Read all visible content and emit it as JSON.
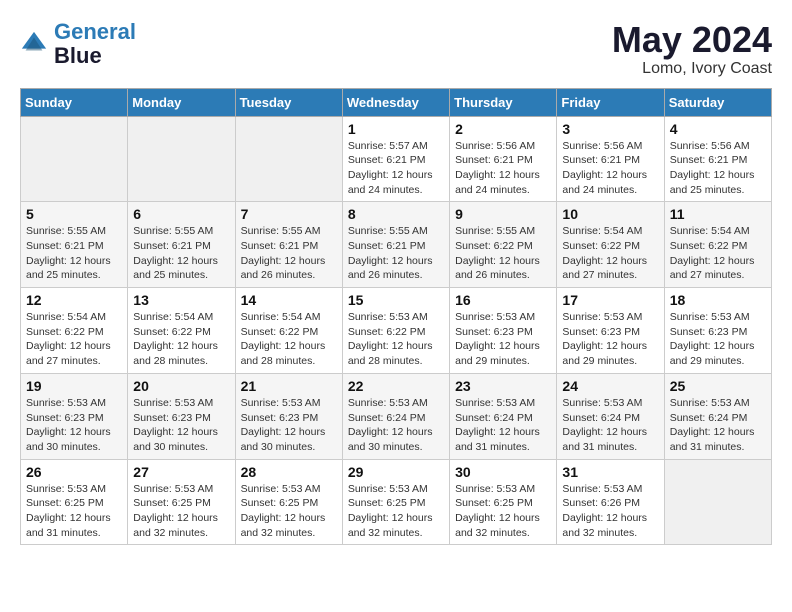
{
  "header": {
    "logo_line1": "General",
    "logo_line2": "Blue",
    "month_year": "May 2024",
    "location": "Lomo, Ivory Coast"
  },
  "days_of_week": [
    "Sunday",
    "Monday",
    "Tuesday",
    "Wednesday",
    "Thursday",
    "Friday",
    "Saturday"
  ],
  "weeks": [
    [
      {
        "day": "",
        "info": ""
      },
      {
        "day": "",
        "info": ""
      },
      {
        "day": "",
        "info": ""
      },
      {
        "day": "1",
        "info": "Sunrise: 5:57 AM\nSunset: 6:21 PM\nDaylight: 12 hours\nand 24 minutes."
      },
      {
        "day": "2",
        "info": "Sunrise: 5:56 AM\nSunset: 6:21 PM\nDaylight: 12 hours\nand 24 minutes."
      },
      {
        "day": "3",
        "info": "Sunrise: 5:56 AM\nSunset: 6:21 PM\nDaylight: 12 hours\nand 24 minutes."
      },
      {
        "day": "4",
        "info": "Sunrise: 5:56 AM\nSunset: 6:21 PM\nDaylight: 12 hours\nand 25 minutes."
      }
    ],
    [
      {
        "day": "5",
        "info": "Sunrise: 5:55 AM\nSunset: 6:21 PM\nDaylight: 12 hours\nand 25 minutes."
      },
      {
        "day": "6",
        "info": "Sunrise: 5:55 AM\nSunset: 6:21 PM\nDaylight: 12 hours\nand 25 minutes."
      },
      {
        "day": "7",
        "info": "Sunrise: 5:55 AM\nSunset: 6:21 PM\nDaylight: 12 hours\nand 26 minutes."
      },
      {
        "day": "8",
        "info": "Sunrise: 5:55 AM\nSunset: 6:21 PM\nDaylight: 12 hours\nand 26 minutes."
      },
      {
        "day": "9",
        "info": "Sunrise: 5:55 AM\nSunset: 6:22 PM\nDaylight: 12 hours\nand 26 minutes."
      },
      {
        "day": "10",
        "info": "Sunrise: 5:54 AM\nSunset: 6:22 PM\nDaylight: 12 hours\nand 27 minutes."
      },
      {
        "day": "11",
        "info": "Sunrise: 5:54 AM\nSunset: 6:22 PM\nDaylight: 12 hours\nand 27 minutes."
      }
    ],
    [
      {
        "day": "12",
        "info": "Sunrise: 5:54 AM\nSunset: 6:22 PM\nDaylight: 12 hours\nand 27 minutes."
      },
      {
        "day": "13",
        "info": "Sunrise: 5:54 AM\nSunset: 6:22 PM\nDaylight: 12 hours\nand 28 minutes."
      },
      {
        "day": "14",
        "info": "Sunrise: 5:54 AM\nSunset: 6:22 PM\nDaylight: 12 hours\nand 28 minutes."
      },
      {
        "day": "15",
        "info": "Sunrise: 5:53 AM\nSunset: 6:22 PM\nDaylight: 12 hours\nand 28 minutes."
      },
      {
        "day": "16",
        "info": "Sunrise: 5:53 AM\nSunset: 6:23 PM\nDaylight: 12 hours\nand 29 minutes."
      },
      {
        "day": "17",
        "info": "Sunrise: 5:53 AM\nSunset: 6:23 PM\nDaylight: 12 hours\nand 29 minutes."
      },
      {
        "day": "18",
        "info": "Sunrise: 5:53 AM\nSunset: 6:23 PM\nDaylight: 12 hours\nand 29 minutes."
      }
    ],
    [
      {
        "day": "19",
        "info": "Sunrise: 5:53 AM\nSunset: 6:23 PM\nDaylight: 12 hours\nand 30 minutes."
      },
      {
        "day": "20",
        "info": "Sunrise: 5:53 AM\nSunset: 6:23 PM\nDaylight: 12 hours\nand 30 minutes."
      },
      {
        "day": "21",
        "info": "Sunrise: 5:53 AM\nSunset: 6:23 PM\nDaylight: 12 hours\nand 30 minutes."
      },
      {
        "day": "22",
        "info": "Sunrise: 5:53 AM\nSunset: 6:24 PM\nDaylight: 12 hours\nand 30 minutes."
      },
      {
        "day": "23",
        "info": "Sunrise: 5:53 AM\nSunset: 6:24 PM\nDaylight: 12 hours\nand 31 minutes."
      },
      {
        "day": "24",
        "info": "Sunrise: 5:53 AM\nSunset: 6:24 PM\nDaylight: 12 hours\nand 31 minutes."
      },
      {
        "day": "25",
        "info": "Sunrise: 5:53 AM\nSunset: 6:24 PM\nDaylight: 12 hours\nand 31 minutes."
      }
    ],
    [
      {
        "day": "26",
        "info": "Sunrise: 5:53 AM\nSunset: 6:25 PM\nDaylight: 12 hours\nand 31 minutes."
      },
      {
        "day": "27",
        "info": "Sunrise: 5:53 AM\nSunset: 6:25 PM\nDaylight: 12 hours\nand 32 minutes."
      },
      {
        "day": "28",
        "info": "Sunrise: 5:53 AM\nSunset: 6:25 PM\nDaylight: 12 hours\nand 32 minutes."
      },
      {
        "day": "29",
        "info": "Sunrise: 5:53 AM\nSunset: 6:25 PM\nDaylight: 12 hours\nand 32 minutes."
      },
      {
        "day": "30",
        "info": "Sunrise: 5:53 AM\nSunset: 6:25 PM\nDaylight: 12 hours\nand 32 minutes."
      },
      {
        "day": "31",
        "info": "Sunrise: 5:53 AM\nSunset: 6:26 PM\nDaylight: 12 hours\nand 32 minutes."
      },
      {
        "day": "",
        "info": ""
      }
    ]
  ]
}
